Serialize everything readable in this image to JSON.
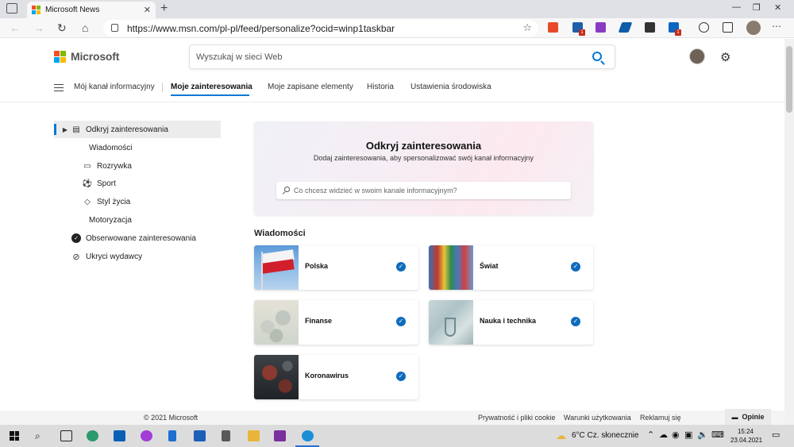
{
  "browser": {
    "tab_title": "Microsoft News",
    "tab_close": "✕",
    "new_tab": "+",
    "url": "https://www.msn.com/pl-pl/feed/personalize?ocid=winp1taskbar",
    "extension_badges": [
      "1",
      "1"
    ],
    "window_controls": [
      "—",
      "❐",
      "✕"
    ]
  },
  "header": {
    "brand": "Microsoft",
    "search_placeholder": "Wyszukaj w sieci Web"
  },
  "nav": {
    "items": [
      "Mój kanał informacyjny",
      "Moje zainteresowania",
      "Moje zapisane elementy",
      "Historia",
      "Ustawienia środowiska"
    ],
    "active_index": 1
  },
  "sidebar": {
    "items": [
      {
        "label": "Odkryj zainteresowania",
        "icon": "discover-icon"
      },
      {
        "label": "Wiadomości",
        "icon": ""
      },
      {
        "label": "Rozrywka",
        "icon": "entertainment-icon"
      },
      {
        "label": "Sport",
        "icon": "sport-icon"
      },
      {
        "label": "Styl życia",
        "icon": "lifestyle-icon"
      },
      {
        "label": "Motoryzacja",
        "icon": ""
      },
      {
        "label": "Obserwowane zainteresowania",
        "icon": "followed-icon"
      },
      {
        "label": "Ukryci wydawcy",
        "icon": "blocked-icon"
      }
    ]
  },
  "hero": {
    "title": "Odkryj zainteresowania",
    "subtitle": "Dodaj zainteresowania, aby spersonalizować swój kanał informacyjny",
    "search_placeholder": "Co chcesz widzieć w swoim kanale informacyjnym?"
  },
  "section": {
    "title": "Wiadomości",
    "cards": [
      {
        "label": "Polska",
        "followed": true
      },
      {
        "label": "Świat",
        "followed": true
      },
      {
        "label": "Finanse",
        "followed": true
      },
      {
        "label": "Nauka i technika",
        "followed": true
      },
      {
        "label": "Koronawirus",
        "followed": true
      }
    ]
  },
  "footer": {
    "copyright": "© 2021 Microsoft",
    "links": [
      "Prywatność i pliki cookie",
      "Warunki użytkowania",
      "Reklamuj się"
    ],
    "feedback": "Opinie"
  },
  "taskbar": {
    "weather": "6°C  Cz. słonecznie",
    "time": "15:24",
    "date": "23.04.2021"
  },
  "colors": {
    "accent": "#0078d4",
    "check": "#0f6cbd"
  }
}
